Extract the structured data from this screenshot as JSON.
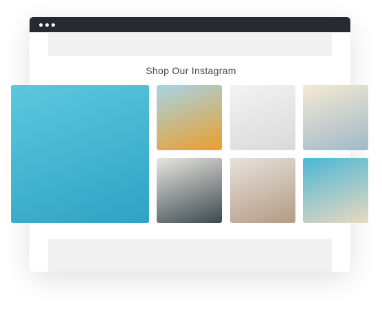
{
  "window": {
    "dots": 3
  },
  "section": {
    "title": "Shop Our Instagram"
  },
  "gallery": {
    "items": [
      {
        "name": "pool-woman-photo",
        "colors": [
          "#5cc8de",
          "#2ea3c4"
        ]
      },
      {
        "name": "orange-van-photo",
        "colors": [
          "#a8d3e6",
          "#e8a02a"
        ]
      },
      {
        "name": "wall-hooks-photo",
        "colors": [
          "#f3f3f3",
          "#d9d9d9"
        ]
      },
      {
        "name": "beach-woman-sun-photo",
        "colors": [
          "#f5e9d2",
          "#9fb9c9"
        ]
      },
      {
        "name": "travel-suitcase-photo",
        "colors": [
          "#e9e6e0",
          "#3b4a4f"
        ]
      },
      {
        "name": "friends-sitting-photo",
        "colors": [
          "#e6e2dc",
          "#b39a83"
        ]
      },
      {
        "name": "straw-hat-photo",
        "colors": [
          "#4bb7d6",
          "#e9d9bf"
        ]
      }
    ]
  }
}
